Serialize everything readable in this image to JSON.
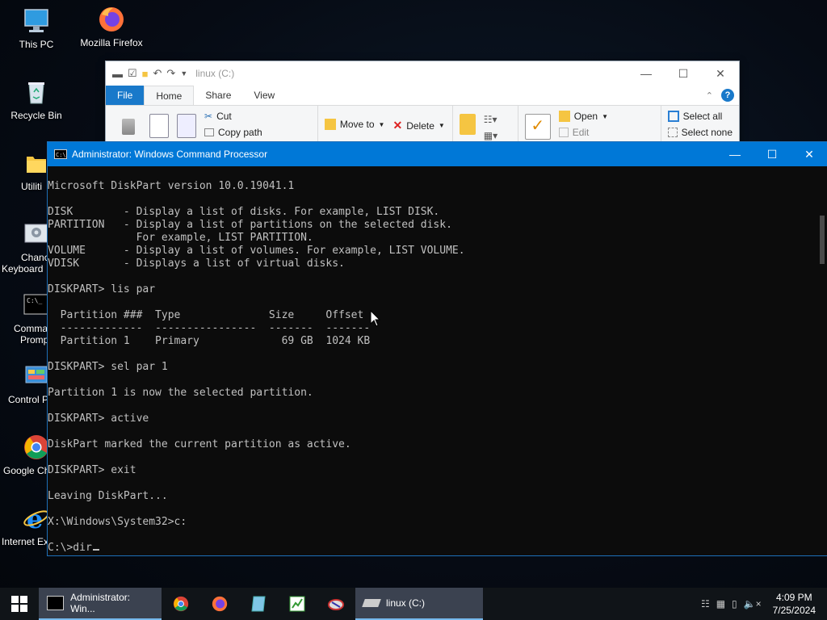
{
  "desktop": {
    "icons": [
      {
        "label": "This PC"
      },
      {
        "label": "Mozilla Firefox"
      },
      {
        "label": "Recycle Bin"
      },
      {
        "label": "Utiliti"
      },
      {
        "label": "Chanc",
        "label2": "Keyboard"
      },
      {
        "label": "Comma",
        "label2": "Promp"
      },
      {
        "label": "Control P"
      },
      {
        "label": "Google Ch"
      },
      {
        "label": "Internet Ex"
      }
    ]
  },
  "explorer": {
    "title": "linux (C:)",
    "tabs": {
      "file": "File",
      "home": "Home",
      "share": "Share",
      "view": "View"
    },
    "ribbon": {
      "cut": "Cut",
      "copy_path": "Copy path",
      "move_to": "Move to",
      "delete": "Delete",
      "open": "Open",
      "edit": "Edit",
      "select_all": "Select all",
      "select_none": "Select none"
    },
    "help": "?"
  },
  "cmd": {
    "title": "Administrator: Windows Command Processor",
    "lines": [
      "",
      "Microsoft DiskPart version 10.0.19041.1",
      "",
      "DISK        - Display a list of disks. For example, LIST DISK.",
      "PARTITION   - Display a list of partitions on the selected disk.",
      "              For example, LIST PARTITION.",
      "VOLUME      - Display a list of volumes. For example, LIST VOLUME.",
      "VDISK       - Displays a list of virtual disks.",
      "",
      "DISKPART> lis par",
      "",
      "  Partition ###  Type              Size     Offset",
      "  -------------  ----------------  -------  -------",
      "  Partition 1    Primary             69 GB  1024 KB",
      "",
      "DISKPART> sel par 1",
      "",
      "Partition 1 is now the selected partition.",
      "",
      "DISKPART> active",
      "",
      "DiskPart marked the current partition as active.",
      "",
      "DISKPART> exit",
      "",
      "Leaving DiskPart...",
      "",
      "X:\\Windows\\System32>c:",
      ""
    ],
    "prompt_line": "C:\\>dir"
  },
  "taskbar": {
    "cmd_task": "Administrator: Win...",
    "explorer_task": "linux (C:)",
    "time": "4:09 PM",
    "date": "7/25/2024"
  },
  "colors": {
    "accent": "#0078d7",
    "console_text": "#c0c0c0",
    "console_bg": "#0c0c0c"
  }
}
